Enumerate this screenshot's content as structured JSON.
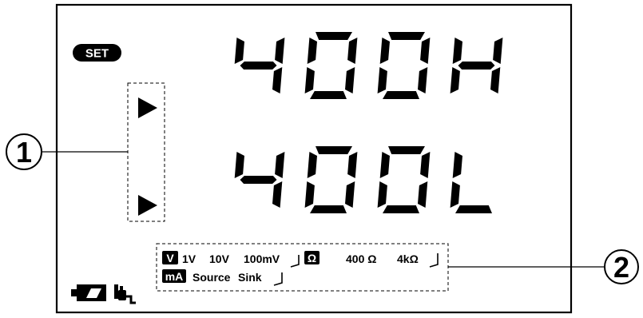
{
  "set_badge": "SET",
  "callouts": [
    "1",
    "2"
  ],
  "display": {
    "line1": "400H",
    "line2": "400L"
  },
  "voltage_range": {
    "unit": "V",
    "options": [
      "1V",
      "10V",
      "100mV"
    ]
  },
  "resistance_range": {
    "unit": "Ω",
    "options": [
      "400 Ω",
      "4kΩ"
    ]
  },
  "current_mode": {
    "unit": "mA",
    "options": [
      "Source",
      "Sink"
    ]
  },
  "status_icons": [
    "battery-icon",
    "power-plug-icon"
  ],
  "colors": {
    "ink": "#000000",
    "background": "#ffffff"
  }
}
